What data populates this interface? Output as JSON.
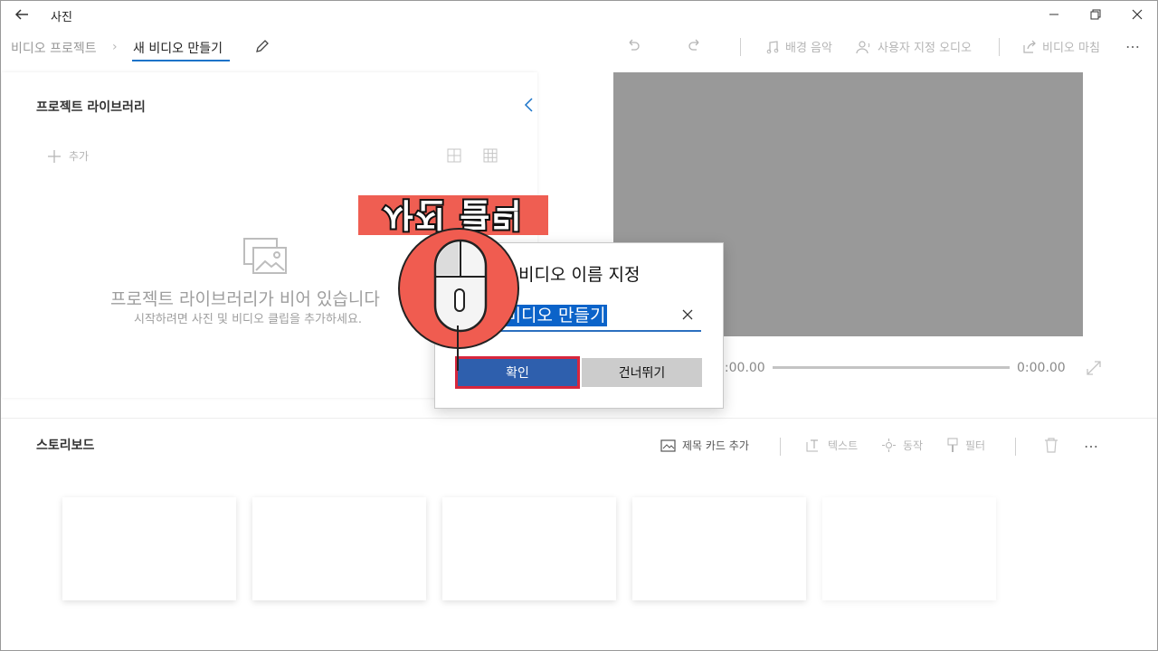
{
  "window": {
    "app_title": "사진",
    "icons": {
      "back": "back-arrow-icon",
      "minimize": "minimize-icon",
      "restore": "restore-icon",
      "close": "close-icon"
    }
  },
  "breadcrumb": {
    "root": "비디오 프로젝트",
    "separator": "›",
    "current": "새 비디오 만들기"
  },
  "toolbar": {
    "background_music": "배경 음악",
    "custom_audio": "사용자 지정 오디오",
    "finish_video": "비디오 마침",
    "more": "…"
  },
  "library": {
    "title": "프로젝트 라이브러리",
    "add_label": "추가",
    "empty_title": "프로젝트 라이브러리가 비어 있습니다",
    "empty_subtitle": "시작하려면 사진 및 비디오 클립을 추가하세요."
  },
  "preview": {
    "time_current": "0:00.00",
    "time_total": "0:00.00",
    "background_color": "#999999"
  },
  "storyboard": {
    "title": "스토리보드",
    "add_title_card": "제목 카드 추가",
    "text": "텍스트",
    "motion": "동작",
    "filter": "필터",
    "more": "…",
    "slots": 5
  },
  "dialog": {
    "title": "비디오 이름 지정",
    "input_value": "새 비디오 만들기",
    "ok_label": "확인",
    "skip_label": "건너뛰기"
  },
  "overlay": {
    "label": "사진 클릭",
    "accent_color": "#ef5e52",
    "highlight_color": "#d7263d"
  },
  "colors": {
    "accent": "#1a73c9",
    "ok_button": "#2e5fad",
    "selection": "#0b63c9"
  }
}
